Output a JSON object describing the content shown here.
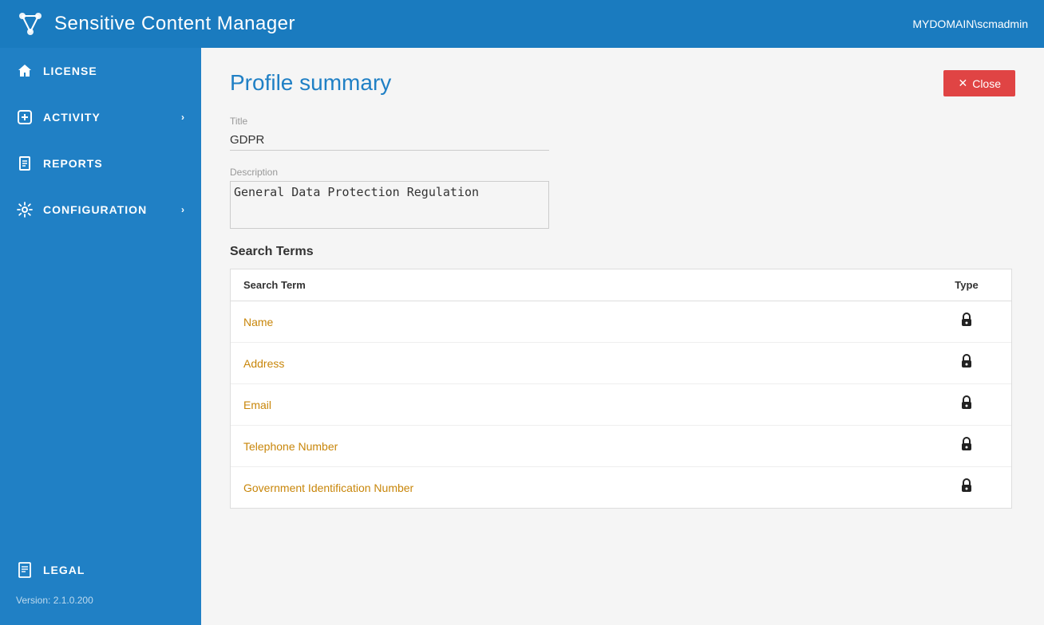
{
  "header": {
    "title": "Sensitive Content Manager",
    "user": "MYDOMAIN\\scmadmin",
    "logo_symbol": "⊹"
  },
  "sidebar": {
    "items": [
      {
        "id": "license",
        "label": "LICENSE",
        "icon": "house",
        "chevron": false
      },
      {
        "id": "activity",
        "label": "ACTIVITY",
        "icon": "plus-circle",
        "chevron": true
      },
      {
        "id": "reports",
        "label": "REPORTS",
        "icon": "document",
        "chevron": false
      },
      {
        "id": "configuration",
        "label": "CONFIGURATION",
        "icon": "gear-circle",
        "chevron": true
      }
    ],
    "bottom_items": [
      {
        "id": "legal",
        "label": "LEGAL",
        "icon": "document-list"
      }
    ],
    "version": "Version: 2.1.0.200"
  },
  "main": {
    "page_title": "Profile summary",
    "close_button_label": "Close",
    "form": {
      "title_label": "Title",
      "title_value": "GDPR",
      "description_label": "Description",
      "description_value": "General Data Protection Regulation"
    },
    "search_terms_section_title": "Search Terms",
    "table": {
      "col_term": "Search Term",
      "col_type": "Type",
      "rows": [
        {
          "term": "Name",
          "type": "lock"
        },
        {
          "term": "Address",
          "type": "lock"
        },
        {
          "term": "Email",
          "type": "lock"
        },
        {
          "term": "Telephone Number",
          "type": "lock"
        },
        {
          "term": "Government Identification Number",
          "type": "lock"
        }
      ]
    }
  },
  "colors": {
    "header_bg": "#1a7bbf",
    "sidebar_bg": "#2080c5",
    "page_title": "#2080c5",
    "close_btn_bg": "#e04444",
    "term_color": "#c8860a"
  }
}
